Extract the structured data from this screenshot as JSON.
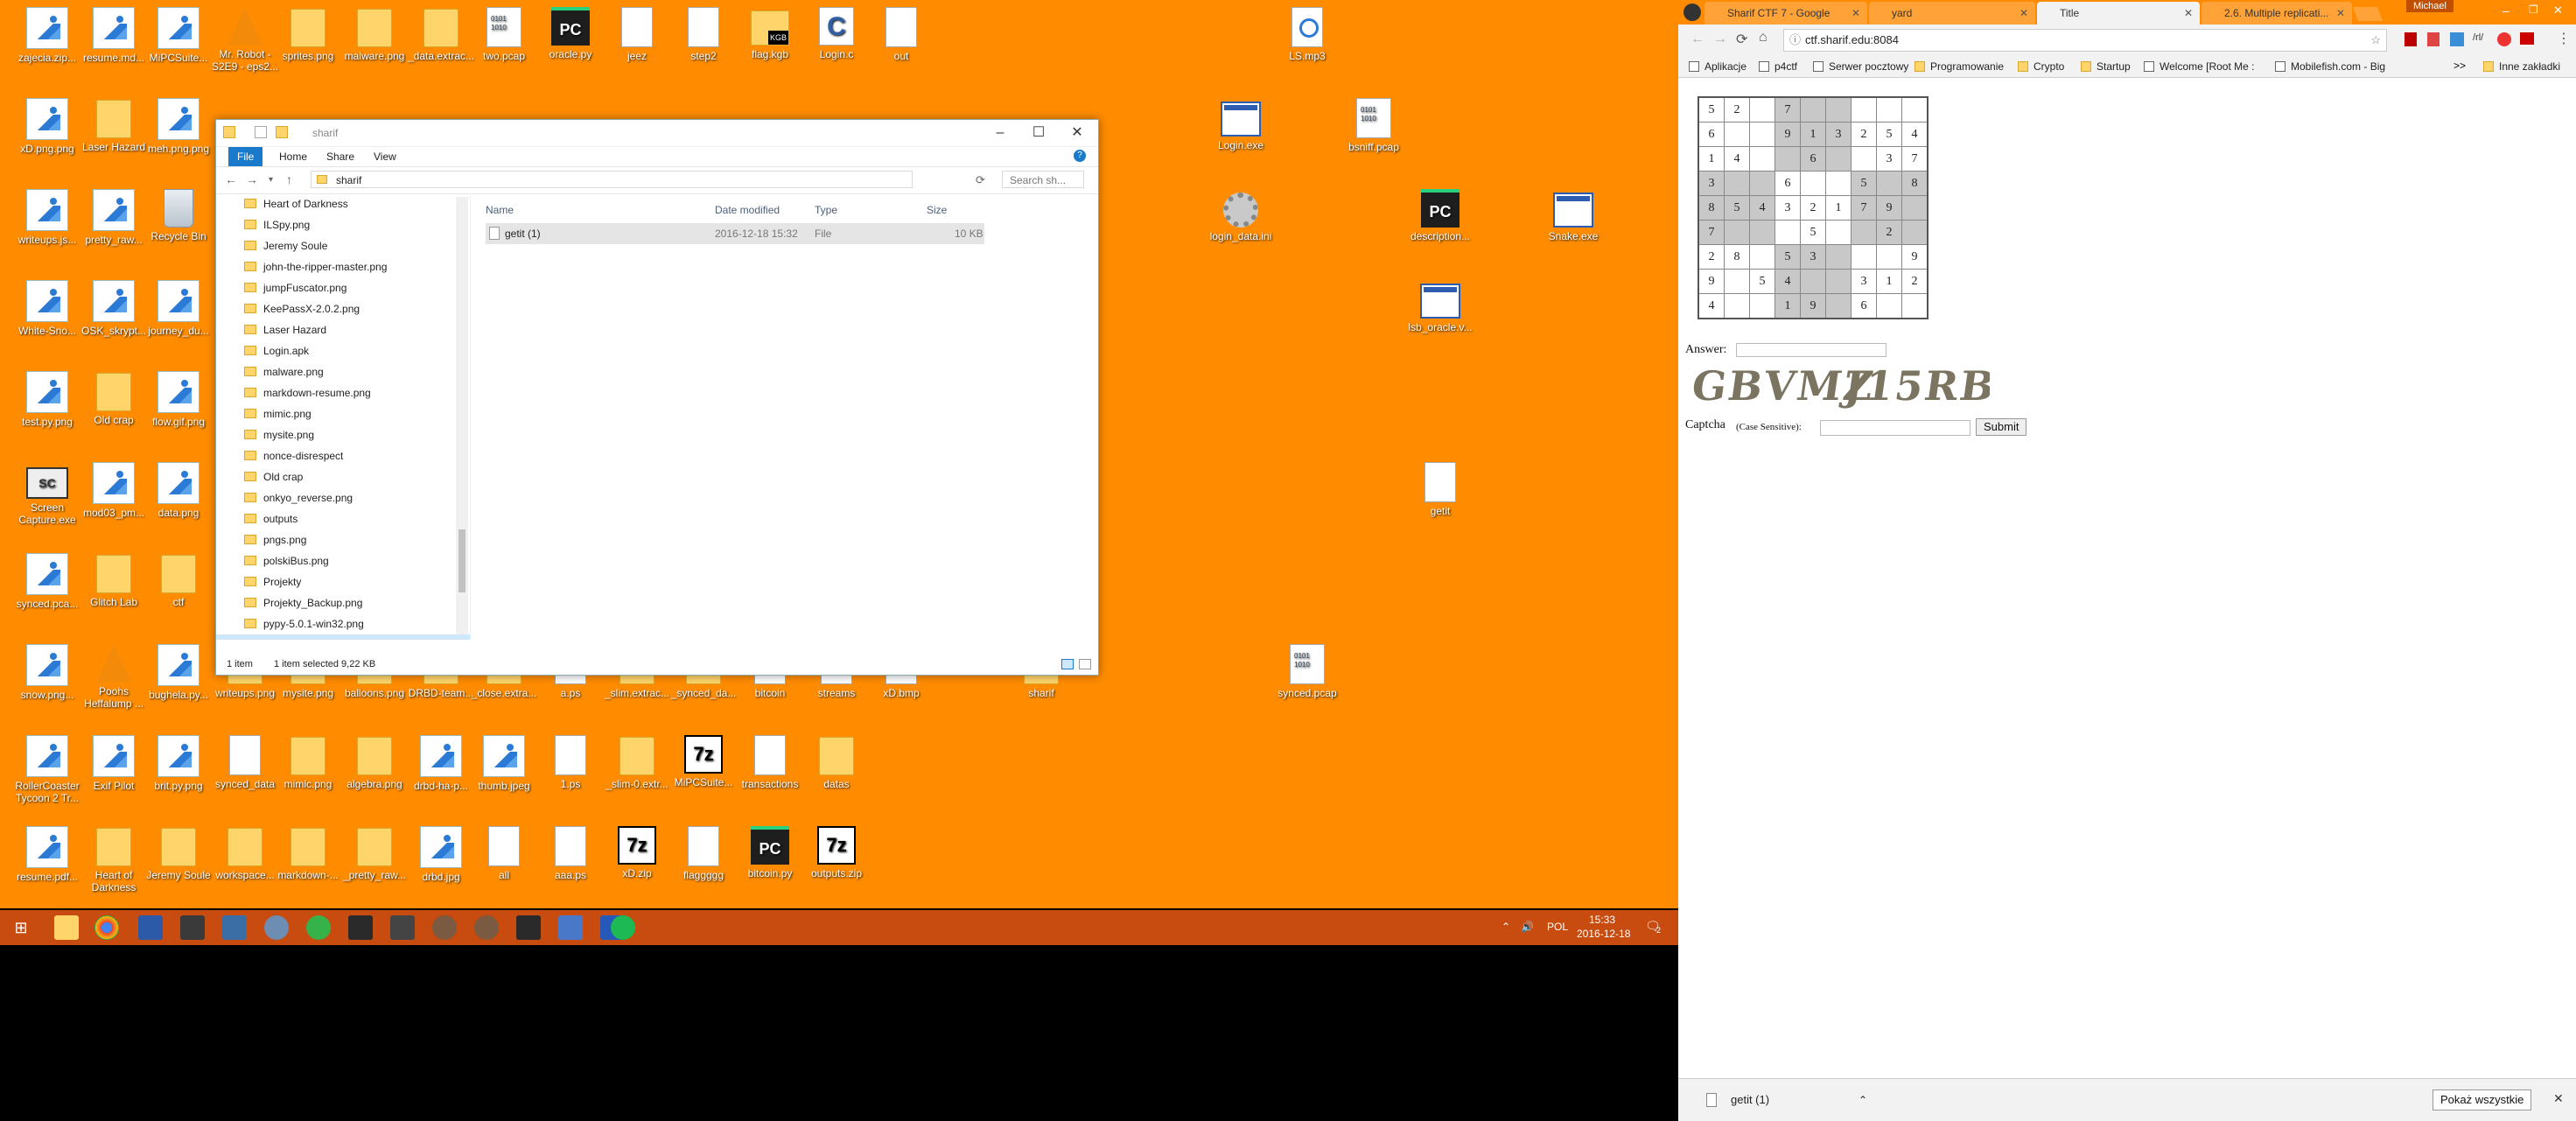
{
  "desktop": {
    "background_color": "#FF8C00",
    "icons": [
      {
        "label": "zajecia.zip...",
        "type": "img"
      },
      {
        "label": "resume.md...",
        "type": "img"
      },
      {
        "label": "MiPCSuite...",
        "type": "img"
      },
      {
        "label": "Mr. Robot - S2E9 - eps2...",
        "type": "vlc"
      },
      {
        "label": "sprites.png",
        "type": "folder"
      },
      {
        "label": "malware.png",
        "type": "folder"
      },
      {
        "label": "_data.extrac...",
        "type": "folder"
      },
      {
        "label": "two.pcap",
        "type": "pcap"
      },
      {
        "label": "oracle.py",
        "type": "pc"
      },
      {
        "label": "jeez",
        "type": "doc"
      },
      {
        "label": "step2",
        "type": "doc"
      },
      {
        "label": "flag.kgb",
        "type": "flagkgb"
      },
      {
        "label": "Login.c",
        "type": "cfile"
      },
      {
        "label": "out",
        "type": "doc"
      },
      {
        "label": "LS.mp3",
        "type": "mp3"
      },
      {
        "label": "xD.png.png",
        "type": "img"
      },
      {
        "label": "Laser Hazard",
        "type": "folder"
      },
      {
        "label": "meh.png.png",
        "type": "img"
      },
      {
        "label": "Login.exe",
        "type": "exe"
      },
      {
        "label": "bsniff.pcap",
        "type": "pcap"
      },
      {
        "label": "writeups.js...",
        "type": "img"
      },
      {
        "label": "pretty_raw...",
        "type": "img"
      },
      {
        "label": "Recycle Bin",
        "type": "bin"
      },
      {
        "label": "login_data.ini",
        "type": "gear"
      },
      {
        "label": "description...",
        "type": "pc"
      },
      {
        "label": "Snake.exe",
        "type": "exe"
      },
      {
        "label": "White-Sno...",
        "type": "img"
      },
      {
        "label": "OSK_skrypt...",
        "type": "img"
      },
      {
        "label": "journey_du...",
        "type": "img"
      },
      {
        "label": "lsb_oracle.v...",
        "type": "exe"
      },
      {
        "label": "test.py.png",
        "type": "img"
      },
      {
        "label": "Old crap",
        "type": "folder"
      },
      {
        "label": "flow.gif.png",
        "type": "img"
      },
      {
        "label": "Screen Capture.exe",
        "type": "cap"
      },
      {
        "label": "mod03_pm...",
        "type": "img"
      },
      {
        "label": "data.png",
        "type": "img"
      },
      {
        "label": "getit",
        "type": "doc"
      },
      {
        "label": "synced.pca...",
        "type": "img"
      },
      {
        "label": "Glitch Lab",
        "type": "folder"
      },
      {
        "label": "ctf",
        "type": "folder"
      },
      {
        "label": "snow.png...",
        "type": "img"
      },
      {
        "label": "Poohs Heffalump ...",
        "type": "vlc"
      },
      {
        "label": "bughela.py...",
        "type": "img"
      },
      {
        "label": "writeups.png",
        "type": "folder"
      },
      {
        "label": "mysite.png",
        "type": "folder"
      },
      {
        "label": "balloons.png",
        "type": "folder"
      },
      {
        "label": "DRBD-team...",
        "type": "folder"
      },
      {
        "label": "_close.extra...",
        "type": "folder"
      },
      {
        "label": "a.ps",
        "type": "doc"
      },
      {
        "label": "_slim.extrac...",
        "type": "folder"
      },
      {
        "label": "_synced_da...",
        "type": "folder"
      },
      {
        "label": "bitcoin",
        "type": "doc"
      },
      {
        "label": "streams",
        "type": "doc"
      },
      {
        "label": "xD.bmp",
        "type": "doc"
      },
      {
        "label": "sharif",
        "type": "folder"
      },
      {
        "label": "synced.pcap",
        "type": "pcap"
      },
      {
        "label": "RollerCoaster Tycoon 2 Tr...",
        "type": "img"
      },
      {
        "label": "Exif Pilot",
        "type": "img"
      },
      {
        "label": "brit.py.png",
        "type": "img"
      },
      {
        "label": "synced_data",
        "type": "doc"
      },
      {
        "label": "mimic.png",
        "type": "folder"
      },
      {
        "label": "algebra.png",
        "type": "folder"
      },
      {
        "label": "drbd-ha-p...",
        "type": "img"
      },
      {
        "label": "thumb.jpeg",
        "type": "img"
      },
      {
        "label": "1.ps",
        "type": "doc"
      },
      {
        "label": "_slim-0.extr...",
        "type": "folder"
      },
      {
        "label": "MiPCSuite...",
        "type": "z7"
      },
      {
        "label": "transactions",
        "type": "doc"
      },
      {
        "label": "datas",
        "type": "folder"
      },
      {
        "label": "resume.pdf...",
        "type": "img"
      },
      {
        "label": "Heart of Darkness",
        "type": "folder"
      },
      {
        "label": "Jeremy Soule",
        "type": "folder"
      },
      {
        "label": "workspace...",
        "type": "folder"
      },
      {
        "label": "markdown-...",
        "type": "folder"
      },
      {
        "label": "_pretty_raw...",
        "type": "folder"
      },
      {
        "label": "drbd.jpg",
        "type": "img"
      },
      {
        "label": "all",
        "type": "doc"
      },
      {
        "label": "aaa.ps",
        "type": "doc"
      },
      {
        "label": "xD.zip",
        "type": "z7"
      },
      {
        "label": "flaggggg",
        "type": "doc"
      },
      {
        "label": "bitcoin.py",
        "type": "pc"
      },
      {
        "label": "outputs.zip",
        "type": "z7"
      }
    ]
  },
  "explorer": {
    "title": "sharif",
    "ribbon_tabs": [
      "File",
      "Home",
      "Share",
      "View"
    ],
    "path": "sharif",
    "search_placeholder": "Search sh...",
    "nav_items": [
      "Heart of Darkness",
      "ILSpy.png",
      "Jeremy Soule",
      "john-the-ripper-master.png",
      "jumpFuscator.png",
      "KeePassX-2.0.2.png",
      "Laser Hazard",
      "Login.apk",
      "malware.png",
      "markdown-resume.png",
      "mimic.png",
      "mysite.png",
      "nonce-disrespect",
      "Old crap",
      "onkyo_reverse.png",
      "outputs",
      "pngs.png",
      "polskiBus.png",
      "Projekty",
      "Projekty_Backup.png",
      "pypy-5.0.1-win32.png",
      "sharif"
    ],
    "selected_nav": "sharif",
    "columns": {
      "name": "Name",
      "date": "Date modified",
      "type": "Type",
      "size": "Size"
    },
    "files": [
      {
        "name": "getit (1)",
        "date": "2016-12-18 15:32",
        "type": "File",
        "size": "10 KB"
      }
    ],
    "status_count": "1 item",
    "status_selected": "1 item selected  9,22 KB"
  },
  "taskbar": {
    "color": "#C84C10",
    "language": "POL",
    "time": "15:33",
    "date": "2016-12-18",
    "notification_count": "2"
  },
  "browser": {
    "user": "Michael",
    "tabs": [
      {
        "title": "Sharif CTF 7 - Google",
        "active": false
      },
      {
        "title": "yard",
        "active": false
      },
      {
        "title": "Title",
        "active": true
      },
      {
        "title": "2.6. Multiple replicati...",
        "active": false
      }
    ],
    "url": "ctf.sharif.edu:8084",
    "bookmarks": [
      "Aplikacje",
      "p4ctf",
      "Serwer pocztowy",
      "Programowanie",
      "Crypto",
      "Startup",
      "Welcome [Root Me :",
      "Mobilefish.com - Big",
      ">>",
      "Inne zakładki"
    ],
    "sudoku": [
      [
        "5",
        "2",
        "",
        "7",
        "",
        "",
        "",
        "",
        ""
      ],
      [
        "6",
        "",
        "",
        "9",
        "1",
        "3",
        "2",
        "5",
        "4"
      ],
      [
        "1",
        "4",
        "",
        "",
        "6",
        "",
        "",
        "3",
        "7"
      ],
      [
        "3",
        "",
        "",
        "6",
        "",
        "",
        "5",
        "",
        "8"
      ],
      [
        "8",
        "5",
        "4",
        "3",
        "2",
        "1",
        "7",
        "9",
        ""
      ],
      [
        "7",
        "",
        "",
        "",
        "5",
        "",
        "",
        "2",
        ""
      ],
      [
        "2",
        "8",
        "",
        "5",
        "3",
        "",
        "",
        "",
        "9"
      ],
      [
        "9",
        "",
        "5",
        "4",
        "",
        "",
        "3",
        "1",
        "2"
      ],
      [
        "4",
        "",
        "",
        "1",
        "9",
        "",
        "6",
        "",
        ""
      ]
    ],
    "answer_label": "Answer:",
    "captcha_text_1": "GBVMZ",
    "captcha_text_2": "J15RB",
    "captcha_label": "Captcha",
    "captcha_hint": "(Case Sensitive):",
    "submit_label": "Submit",
    "download_file": "getit (1)",
    "show_all_label": "Pokaż wszystkie"
  }
}
